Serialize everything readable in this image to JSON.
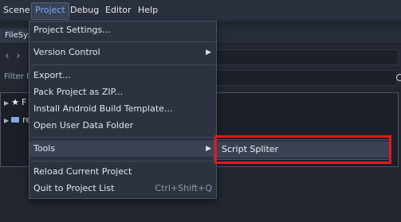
{
  "menubar": {
    "items": [
      "Scene",
      "Project",
      "Debug",
      "Editor",
      "Help"
    ],
    "active": "Project"
  },
  "dock": {
    "tab_label": "FileSys",
    "filter_label": "Filter Fi",
    "tree": [
      {
        "icon": "star-icon",
        "label": "F"
      },
      {
        "icon": "folder-icon",
        "label": "re"
      }
    ]
  },
  "project_menu": {
    "items": [
      {
        "label": "Project Settings...",
        "submenu": false,
        "shortcut": ""
      },
      {
        "label": "Version Control",
        "submenu": true,
        "shortcut": ""
      },
      {
        "label": "Export...",
        "submenu": false,
        "shortcut": ""
      },
      {
        "label": "Pack Project as ZIP...",
        "submenu": false,
        "shortcut": ""
      },
      {
        "label": "Install Android Build Template...",
        "submenu": false,
        "shortcut": ""
      },
      {
        "label": "Open User Data Folder",
        "submenu": false,
        "shortcut": ""
      },
      {
        "label": "Tools",
        "submenu": true,
        "shortcut": ""
      },
      {
        "label": "Reload Current Project",
        "submenu": false,
        "shortcut": ""
      },
      {
        "label": "Quit to Project List",
        "submenu": false,
        "shortcut": "Ctrl+Shift+Q"
      }
    ]
  },
  "tools_submenu": {
    "items": [
      {
        "label": "Script Spliter"
      }
    ]
  },
  "colors": {
    "accent_text": "#78a6ff",
    "annotation_box": "#e0191c",
    "menu_bg": "#2c3240",
    "highlight_bg": "#3b4253"
  }
}
